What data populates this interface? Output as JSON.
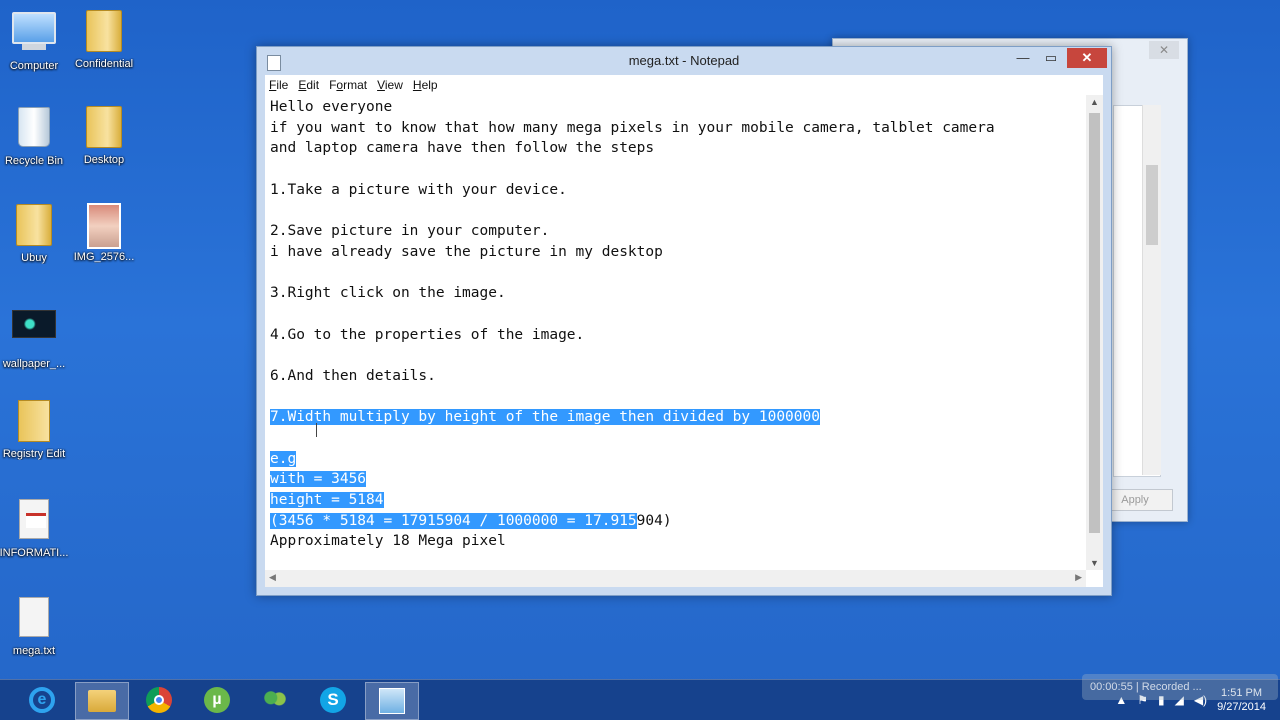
{
  "desktop": {
    "icons": [
      {
        "label": "Computer"
      },
      {
        "label": "Confidential"
      },
      {
        "label": "Recycle Bin"
      },
      {
        "label": "Desktop"
      },
      {
        "label": "Ubuy"
      },
      {
        "label": "IMG_2576..."
      },
      {
        "label": "wallpaper_..."
      },
      {
        "label": "Registry Edit"
      },
      {
        "label": "INFORMATI..."
      },
      {
        "label": "mega.txt"
      }
    ]
  },
  "background_window": {
    "close_glyph": "✕",
    "apply_label": "Apply"
  },
  "notepad": {
    "title": "mega.txt - Notepad",
    "min_glyph": "—",
    "max_glyph": "▭",
    "close_glyph": "✕",
    "menu": [
      {
        "accel": "F",
        "rest": "ile"
      },
      {
        "accel": "E",
        "rest": "dit"
      },
      {
        "accel": "F",
        "rest": "o",
        "accel_pos": "after_o",
        "full": "Format"
      },
      {
        "accel": "V",
        "rest": "iew"
      },
      {
        "accel": "H",
        "rest": "elp"
      }
    ],
    "menu_labels": [
      "File",
      "Edit",
      "Format",
      "View",
      "Help"
    ],
    "lines": [
      "Hello everyone",
      "if you want to know that how many mega pixels in your mobile camera, talblet camera",
      "and laptop camera have then follow the steps",
      "",
      "1.Take a picture with your device.",
      "",
      "2.Save picture in your computer.",
      "i have already save the picture in my desktop",
      "",
      "3.Right click on the image.",
      "",
      "4.Go to the properties of the image.",
      "",
      "6.And then details.",
      "",
      "7.Width multiply by height of the image then divided by 1000000",
      "",
      "e.g",
      "with = 3456",
      "height = 5184",
      "(3456 * 5184 = 17915904 / 1000000 = 17.915904)",
      "Approximately 18 Mega pixel"
    ],
    "selection": {
      "from_line": 15,
      "to_line": 20,
      "last_line_selected_chars": 42
    }
  },
  "taskbar": {
    "apps": [
      "internet-explorer",
      "file-explorer",
      "chrome",
      "utorrent",
      "people",
      "skype",
      "notepad"
    ],
    "clock_time": "1:51 PM",
    "clock_date": "9/27/2014",
    "recorder_text": "00:00:55 | Recorded ..."
  }
}
